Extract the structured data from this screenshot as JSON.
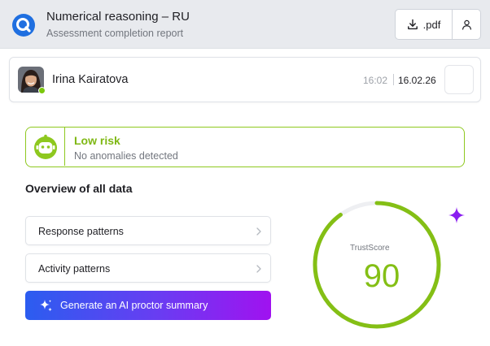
{
  "header": {
    "title": "Numerical reasoning – RU",
    "subtitle": "Assessment completion report",
    "pdf_label": ".pdf",
    "icons": [
      "app-logo-icon",
      "download-icon",
      "user-icon"
    ]
  },
  "candidate": {
    "name": "Irina Kairatova",
    "time": "16:02",
    "date": "16.02.26",
    "status_color": "#7ac70c"
  },
  "risk": {
    "title": "Low risk",
    "subtitle": "No anomalies detected",
    "color": "#8ec81f"
  },
  "overview": {
    "title": "Overview of all data",
    "patterns": [
      {
        "label": "Response patterns"
      },
      {
        "label": "Activity patterns"
      }
    ],
    "ai_button_label": "Generate an AI proctor summary"
  },
  "trust_score": {
    "label": "TrustScore",
    "value": "90",
    "fraction": 0.9,
    "color": "#84bf15"
  },
  "colors": {
    "accent_blue": "#1f6fe0",
    "gradient_start": "#2b5df0",
    "gradient_end": "#a012f0",
    "sparkle": "#8a1ef0"
  }
}
